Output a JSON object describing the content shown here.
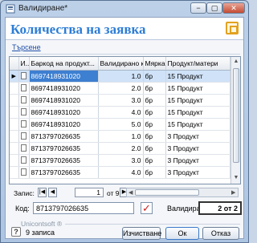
{
  "window": {
    "title": "Валидиране*",
    "buttons": {
      "minimize": "−",
      "maximize": "▢",
      "close": "✕"
    }
  },
  "header": {
    "title": "Количества на заявка"
  },
  "search": {
    "label": "Търсене"
  },
  "table": {
    "columns": [
      "И...",
      "Баркод на продукт...",
      "Валидирано кол...",
      "Мярка",
      "Продукт/матери"
    ],
    "rows": [
      {
        "barcode": "8697418931020",
        "qty": "1.0",
        "unit": "бр",
        "product": "15 Продукт",
        "selected": true
      },
      {
        "barcode": "8697418931020",
        "qty": "2.0",
        "unit": "бр",
        "product": "15 Продукт"
      },
      {
        "barcode": "8697418931020",
        "qty": "3.0",
        "unit": "бр",
        "product": "15 Продукт"
      },
      {
        "barcode": "8697418931020",
        "qty": "4.0",
        "unit": "бр",
        "product": "15 Продукт"
      },
      {
        "barcode": "8697418931020",
        "qty": "5.0",
        "unit": "бр",
        "product": "15 Продукт"
      },
      {
        "barcode": "8713797026635",
        "qty": "1.0",
        "unit": "бр",
        "product": "3 Продукт"
      },
      {
        "barcode": "8713797026635",
        "qty": "2.0",
        "unit": "бр",
        "product": "3 Продукт"
      },
      {
        "barcode": "8713797026635",
        "qty": "3.0",
        "unit": "бр",
        "product": "3 Продукт"
      },
      {
        "barcode": "8713797026635",
        "qty": "4.0",
        "unit": "бр",
        "product": "3 Продукт"
      }
    ]
  },
  "navigator": {
    "label": "Запис:",
    "current": "1",
    "total_text": "от 9"
  },
  "code": {
    "label": "Код:",
    "value": "8713797026635"
  },
  "validated": {
    "label": "Валидирани:",
    "value": "2 от 2"
  },
  "brand": "Unicontsoft ®",
  "status": {
    "text": "9 записа"
  },
  "buttons": {
    "clear": "Изчистване",
    "ok": "Ок",
    "cancel": "Отказ"
  }
}
